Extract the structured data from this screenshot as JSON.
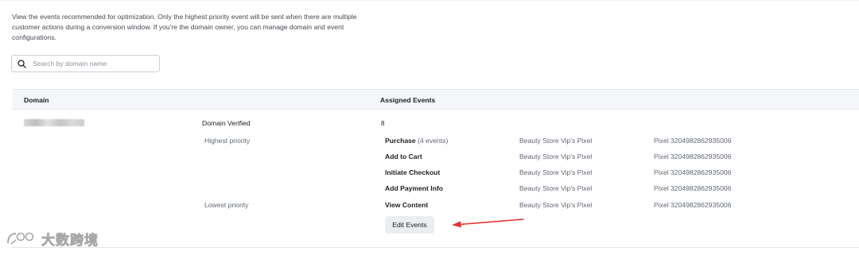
{
  "description": "View the events recommended for optimization. Only the highest priority event will be sent when there are multiple customer actions during a conversion window. If you're the domain owner, you can manage domain and event configurations.",
  "search": {
    "placeholder": "Search by domain name",
    "value": ""
  },
  "table": {
    "headers": {
      "domain": "Domain",
      "assigned_events": "Assigned Events"
    },
    "row": {
      "domain_status": "Domain Verified",
      "event_count": "8",
      "priority_high_label": "Highest priority",
      "priority_low_label": "Lowest priority",
      "events": [
        {
          "name": "Purchase",
          "count_note": "(4 events)",
          "pixel_name": "Beauty Store Vip's Pixel",
          "pixel_id": "Pixel 3204982862935006"
        },
        {
          "name": "Add to Cart",
          "count_note": "",
          "pixel_name": "Beauty Store Vip's Pixel",
          "pixel_id": "Pixel 3204982862935006"
        },
        {
          "name": "Initiate Checkout",
          "count_note": "",
          "pixel_name": "Beauty Store Vip's Pixel",
          "pixel_id": "Pixel 3204982862935006"
        },
        {
          "name": "Add Payment Info",
          "count_note": "",
          "pixel_name": "Beauty Store Vip's Pixel",
          "pixel_id": "Pixel 3204982862935006"
        },
        {
          "name": "View Content",
          "count_note": "",
          "pixel_name": "Beauty Store Vip's Pixel",
          "pixel_id": "Pixel 3204982862935006"
        }
      ],
      "edit_button_label": "Edit Events"
    }
  },
  "watermark_text": "大数跨境",
  "colors": {
    "annotation_arrow": "#e8322d",
    "header_bg": "#f5f6f7",
    "button_bg": "#ebedf0"
  },
  "icons": {
    "search": "search-icon",
    "arrow": "annotation-arrow",
    "watermark_logo": "watermark-logo-icon"
  }
}
